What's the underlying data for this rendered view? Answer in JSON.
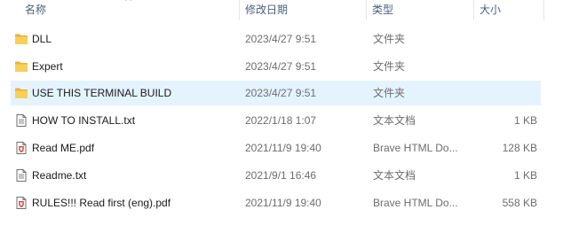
{
  "columns": {
    "name": "名称",
    "date_modified": "修改日期",
    "type": "类型",
    "size": "大小"
  },
  "files": [
    {
      "icon": "folder-icon",
      "name": "DLL",
      "date": "2023/4/27 9:51",
      "type": "文件夹",
      "size": "",
      "selected": false
    },
    {
      "icon": "folder-icon",
      "name": "Expert",
      "date": "2023/4/27 9:51",
      "type": "文件夹",
      "size": "",
      "selected": false
    },
    {
      "icon": "folder-icon",
      "name": "USE THIS TERMINAL BUILD",
      "date": "2023/4/27 9:51",
      "type": "文件夹",
      "size": "",
      "selected": true
    },
    {
      "icon": "text-file-icon",
      "name": "HOW TO INSTALL.txt",
      "date": "2022/1/18 1:07",
      "type": "文本文档",
      "size": "1 KB",
      "selected": false
    },
    {
      "icon": "pdf-file-icon",
      "name": "Read ME.pdf",
      "date": "2021/11/9 19:40",
      "type": "Brave HTML Do...",
      "size": "128 KB",
      "selected": false
    },
    {
      "icon": "text-file-icon",
      "name": "Readme.txt",
      "date": "2021/9/1 16:46",
      "type": "文本文档",
      "size": "1 KB",
      "selected": false
    },
    {
      "icon": "pdf-file-icon",
      "name": "RULES!!! Read first (eng).pdf",
      "date": "2021/11/9 19:40",
      "type": "Brave HTML Do...",
      "size": "558 KB",
      "selected": false
    }
  ],
  "colors": {
    "selected_row": "#e5f3ff",
    "header_text": "#4c607a",
    "folder": "#f8cf5a",
    "pdf_accent": "#e0443a"
  }
}
